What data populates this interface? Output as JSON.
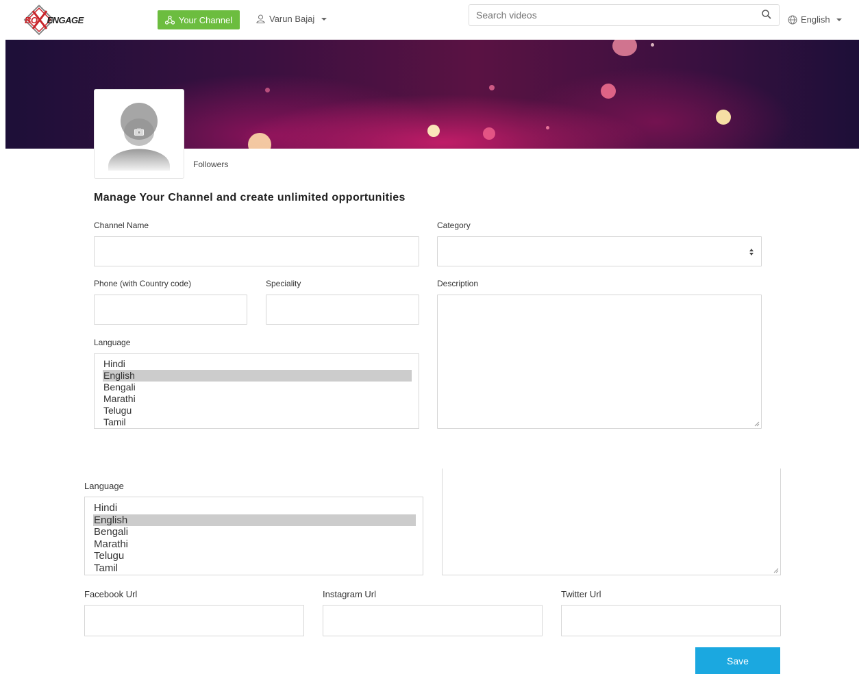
{
  "header": {
    "logo": {
      "part1": "BO",
      "part2": "ENGAGE"
    },
    "channel_button": "Your Channel",
    "user_name": "Varun Bajaj",
    "search_placeholder": "Search videos",
    "language": "English"
  },
  "profile": {
    "followers_label": "Followers"
  },
  "form": {
    "heading": "Manage Your Channel and create unlimited opportunities",
    "channel_name_label": "Channel Name",
    "category_label": "Category",
    "phone_label": "Phone (with Country code)",
    "speciality_label": "Speciality",
    "description_label": "Description",
    "language_label": "Language",
    "language_options": [
      "Hindi",
      "English",
      "Bengali",
      "Marathi",
      "Telugu",
      "Tamil"
    ],
    "language_selected": "English"
  },
  "form_lower": {
    "language_label": "Language",
    "language_options": [
      "Hindi",
      "English",
      "Bengali",
      "Marathi",
      "Telugu",
      "Tamil"
    ],
    "facebook_label": "Facebook Url",
    "instagram_label": "Instagram Url",
    "twitter_label": "Twitter Url",
    "save_label": "Save"
  },
  "colors": {
    "channel_button": "#6cbd3f",
    "save_button": "#1ba8e0",
    "logo_red": "#c8242a"
  }
}
